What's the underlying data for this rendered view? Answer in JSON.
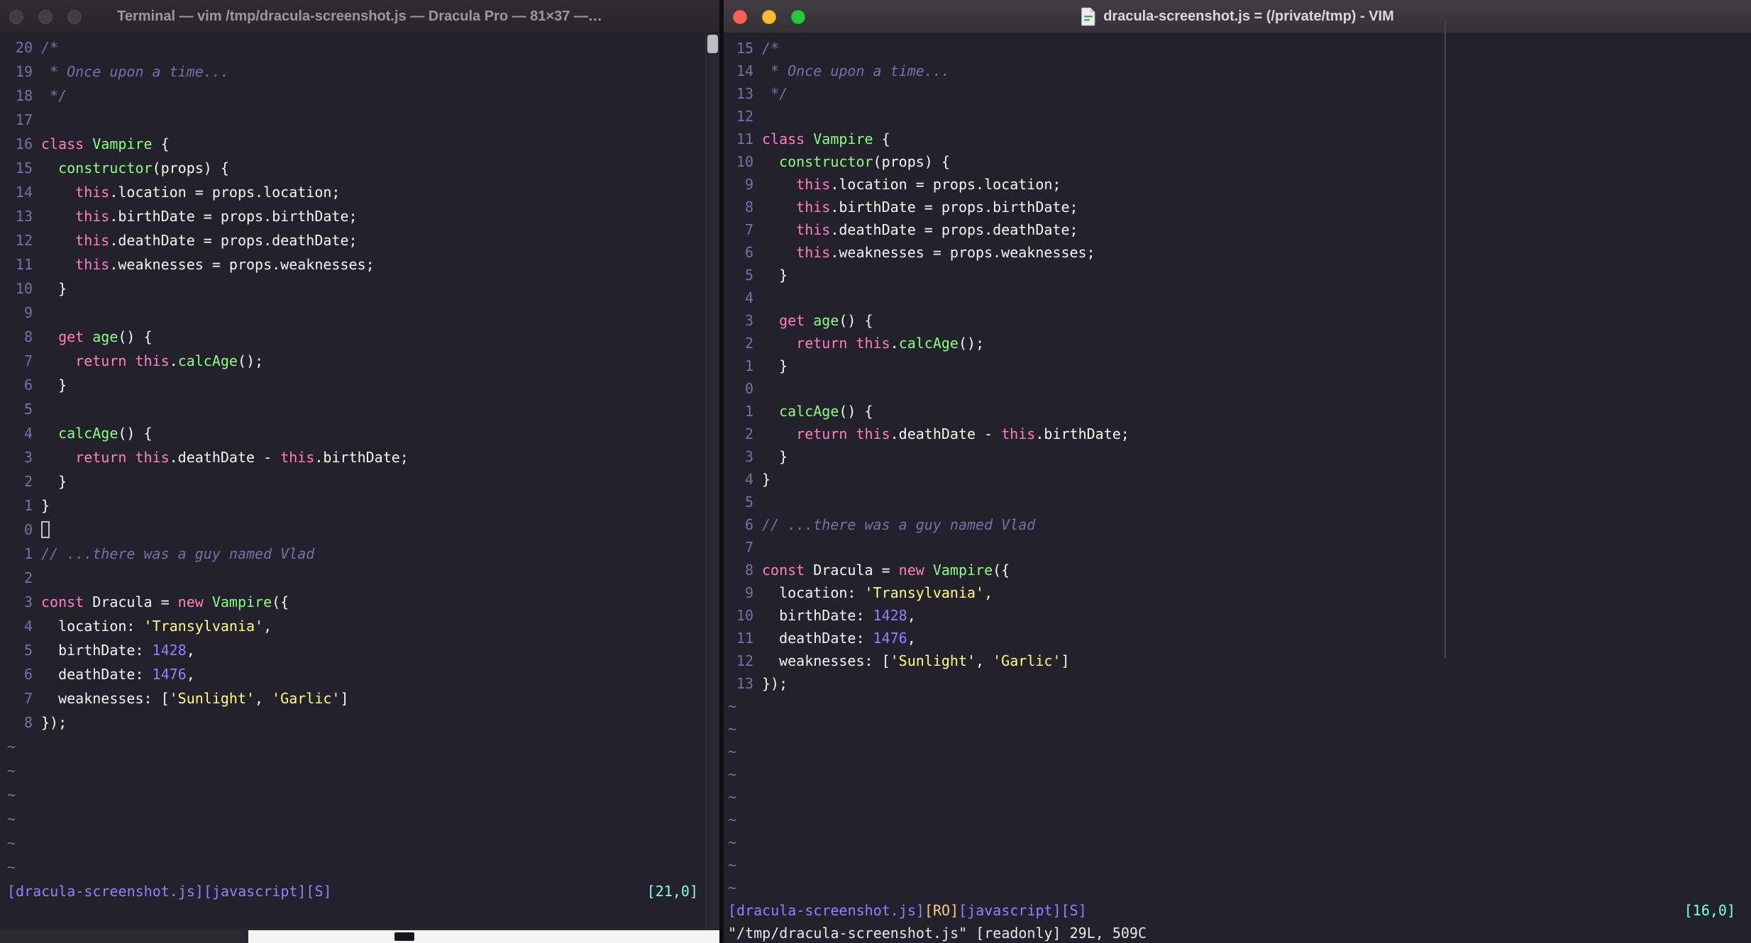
{
  "colors": {
    "bg": "#22212C",
    "fg": "#F8F8F2",
    "comment": "#7970A9",
    "pink": "#FF80BF",
    "green": "#8AFF80",
    "yellow": "#FFFF80",
    "purple": "#9580FF",
    "cyan": "#80FFEA",
    "orange": "#FFCA80",
    "tl-red": "#FF5F57",
    "tl-yellow": "#FEBC2E",
    "tl-green": "#28C840"
  },
  "tilde_char": "~",
  "left_window": {
    "title": "Terminal — vim /tmp/dracula-screenshot.js — Dracula Pro — 81×37 —…",
    "lines": [
      {
        "num": "20",
        "t": [
          [
            "com",
            "/*"
          ]
        ]
      },
      {
        "num": "19",
        "t": [
          [
            "com",
            " * Once upon a time..."
          ]
        ]
      },
      {
        "num": "18",
        "t": [
          [
            "com",
            " */"
          ]
        ]
      },
      {
        "num": "17",
        "t": []
      },
      {
        "num": "16",
        "t": [
          [
            "kw",
            "class"
          ],
          [
            "fg",
            " "
          ],
          [
            "fn",
            "Vampire"
          ],
          [
            "fg",
            " {"
          ]
        ]
      },
      {
        "num": "15",
        "t": [
          [
            "fg",
            "  "
          ],
          [
            "fn",
            "constructor"
          ],
          [
            "fg",
            "(props) {"
          ]
        ]
      },
      {
        "num": "14",
        "t": [
          [
            "fg",
            "    "
          ],
          [
            "kw",
            "this"
          ],
          [
            "fg",
            ".location = props.location;"
          ]
        ]
      },
      {
        "num": "13",
        "t": [
          [
            "fg",
            "    "
          ],
          [
            "kw",
            "this"
          ],
          [
            "fg",
            ".birthDate = props.birthDate;"
          ]
        ]
      },
      {
        "num": "12",
        "t": [
          [
            "fg",
            "    "
          ],
          [
            "kw",
            "this"
          ],
          [
            "fg",
            ".deathDate = props.deathDate;"
          ]
        ]
      },
      {
        "num": "11",
        "t": [
          [
            "fg",
            "    "
          ],
          [
            "kw",
            "this"
          ],
          [
            "fg",
            ".weaknesses = props.weaknesses;"
          ]
        ]
      },
      {
        "num": "10",
        "t": [
          [
            "fg",
            "  }"
          ]
        ]
      },
      {
        "num": "9",
        "t": []
      },
      {
        "num": "8",
        "t": [
          [
            "fg",
            "  "
          ],
          [
            "kw",
            "get"
          ],
          [
            "fg",
            " "
          ],
          [
            "fn",
            "age"
          ],
          [
            "fg",
            "() {"
          ]
        ]
      },
      {
        "num": "7",
        "t": [
          [
            "fg",
            "    "
          ],
          [
            "kw",
            "return"
          ],
          [
            "fg",
            " "
          ],
          [
            "kw",
            "this"
          ],
          [
            "fg",
            "."
          ],
          [
            "fn",
            "calcAge"
          ],
          [
            "fg",
            "();"
          ]
        ]
      },
      {
        "num": "6",
        "t": [
          [
            "fg",
            "  }"
          ]
        ]
      },
      {
        "num": "5",
        "t": []
      },
      {
        "num": "4",
        "t": [
          [
            "fg",
            "  "
          ],
          [
            "fn",
            "calcAge"
          ],
          [
            "fg",
            "() {"
          ]
        ]
      },
      {
        "num": "3",
        "t": [
          [
            "fg",
            "    "
          ],
          [
            "kw",
            "return"
          ],
          [
            "fg",
            " "
          ],
          [
            "kw",
            "this"
          ],
          [
            "fg",
            ".deathDate - "
          ],
          [
            "kw",
            "this"
          ],
          [
            "fg",
            ".birthDate;"
          ]
        ]
      },
      {
        "num": "2",
        "t": [
          [
            "fg",
            "  }"
          ]
        ]
      },
      {
        "num": "1",
        "t": [
          [
            "fg",
            "}"
          ]
        ]
      },
      {
        "num": "0",
        "t": [
          [
            "hcur",
            " "
          ]
        ]
      },
      {
        "num": "1",
        "t": [
          [
            "com",
            "// ...there was a guy named Vlad"
          ]
        ]
      },
      {
        "num": "2",
        "t": []
      },
      {
        "num": "3",
        "t": [
          [
            "kw",
            "const"
          ],
          [
            "fg",
            " Dracula = "
          ],
          [
            "kw",
            "new"
          ],
          [
            "fg",
            " "
          ],
          [
            "fn",
            "Vampire"
          ],
          [
            "fg",
            "({"
          ]
        ]
      },
      {
        "num": "4",
        "t": [
          [
            "fg",
            "  location: "
          ],
          [
            "str",
            "'Transylvania'"
          ],
          [
            "fg",
            ","
          ]
        ]
      },
      {
        "num": "5",
        "t": [
          [
            "fg",
            "  birthDate: "
          ],
          [
            "nm",
            "1428"
          ],
          [
            "fg",
            ","
          ]
        ]
      },
      {
        "num": "6",
        "t": [
          [
            "fg",
            "  deathDate: "
          ],
          [
            "nm",
            "1476"
          ],
          [
            "fg",
            ","
          ]
        ]
      },
      {
        "num": "7",
        "t": [
          [
            "fg",
            "  weaknesses: ["
          ],
          [
            "str",
            "'Sunlight'"
          ],
          [
            "fg",
            ", "
          ],
          [
            "str",
            "'Garlic'"
          ],
          [
            "fg",
            "]"
          ]
        ]
      },
      {
        "num": "8",
        "t": [
          [
            "fg",
            "});"
          ]
        ]
      }
    ],
    "tilde_count": 6,
    "status_tokens": [
      [
        "file",
        "[dracula-screenshot.js][javascript][S]"
      ]
    ],
    "ruler": "[21,0]"
  },
  "right_window": {
    "title": "dracula-screenshot.js = (/private/tmp) - VIM",
    "lines": [
      {
        "num": "15",
        "t": [
          [
            "com",
            "/*"
          ]
        ]
      },
      {
        "num": "14",
        "t": [
          [
            "com",
            " * Once upon a time..."
          ]
        ]
      },
      {
        "num": "13",
        "t": [
          [
            "com",
            " */"
          ]
        ]
      },
      {
        "num": "12",
        "t": []
      },
      {
        "num": "11",
        "t": [
          [
            "kw",
            "class"
          ],
          [
            "fg",
            " "
          ],
          [
            "fn",
            "Vampire"
          ],
          [
            "fg",
            " {"
          ]
        ]
      },
      {
        "num": "10",
        "t": [
          [
            "fg",
            "  "
          ],
          [
            "fn",
            "constructor"
          ],
          [
            "fg",
            "(props) {"
          ]
        ]
      },
      {
        "num": "9",
        "t": [
          [
            "fg",
            "    "
          ],
          [
            "kw",
            "this"
          ],
          [
            "fg",
            ".location = props.location;"
          ]
        ]
      },
      {
        "num": "8",
        "t": [
          [
            "fg",
            "    "
          ],
          [
            "kw",
            "this"
          ],
          [
            "fg",
            ".birthDate = props.birthDate;"
          ]
        ]
      },
      {
        "num": "7",
        "t": [
          [
            "fg",
            "    "
          ],
          [
            "kw",
            "this"
          ],
          [
            "fg",
            ".deathDate = props.deathDate;"
          ]
        ]
      },
      {
        "num": "6",
        "t": [
          [
            "fg",
            "    "
          ],
          [
            "kw",
            "this"
          ],
          [
            "fg",
            ".weaknesses = props.weaknesses;"
          ]
        ]
      },
      {
        "num": "5",
        "t": [
          [
            "fg",
            "  }"
          ]
        ]
      },
      {
        "num": "4",
        "t": []
      },
      {
        "num": "3",
        "t": [
          [
            "fg",
            "  "
          ],
          [
            "kw",
            "get"
          ],
          [
            "fg",
            " "
          ],
          [
            "fn",
            "age"
          ],
          [
            "fg",
            "() {"
          ]
        ]
      },
      {
        "num": "2",
        "t": [
          [
            "fg",
            "    "
          ],
          [
            "kw",
            "return"
          ],
          [
            "fg",
            " "
          ],
          [
            "kw",
            "this"
          ],
          [
            "fg",
            "."
          ],
          [
            "fn",
            "calcAge"
          ],
          [
            "fg",
            "();"
          ]
        ]
      },
      {
        "num": "1",
        "t": [
          [
            "fg",
            "  }"
          ]
        ]
      },
      {
        "num": "0",
        "t": []
      },
      {
        "num": "1",
        "t": [
          [
            "fg",
            "  "
          ],
          [
            "fn",
            "calcAge"
          ],
          [
            "fg",
            "() {"
          ]
        ]
      },
      {
        "num": "2",
        "t": [
          [
            "fg",
            "    "
          ],
          [
            "kw",
            "return"
          ],
          [
            "fg",
            " "
          ],
          [
            "kw",
            "this"
          ],
          [
            "fg",
            ".deathDate - "
          ],
          [
            "kw",
            "this"
          ],
          [
            "fg",
            ".birthDate;"
          ]
        ]
      },
      {
        "num": "3",
        "t": [
          [
            "fg",
            "  }"
          ]
        ]
      },
      {
        "num": "4",
        "t": [
          [
            "fg",
            "}"
          ]
        ]
      },
      {
        "num": "5",
        "t": []
      },
      {
        "num": "6",
        "t": [
          [
            "com",
            "// ...there was a guy named Vlad"
          ]
        ]
      },
      {
        "num": "7",
        "t": []
      },
      {
        "num": "8",
        "t": [
          [
            "kw",
            "const"
          ],
          [
            "fg",
            " Dracula = "
          ],
          [
            "kw",
            "new"
          ],
          [
            "fg",
            " "
          ],
          [
            "fn",
            "Vampire"
          ],
          [
            "fg",
            "({"
          ]
        ]
      },
      {
        "num": "9",
        "t": [
          [
            "fg",
            "  location: "
          ],
          [
            "str",
            "'Transylvania'"
          ],
          [
            "fg",
            ","
          ]
        ]
      },
      {
        "num": "10",
        "t": [
          [
            "fg",
            "  birthDate: "
          ],
          [
            "nm",
            "1428"
          ],
          [
            "fg",
            ","
          ]
        ]
      },
      {
        "num": "11",
        "t": [
          [
            "fg",
            "  deathDate: "
          ],
          [
            "nm",
            "1476"
          ],
          [
            "fg",
            ","
          ]
        ]
      },
      {
        "num": "12",
        "t": [
          [
            "fg",
            "  weaknesses: ["
          ],
          [
            "str",
            "'Sunlight'"
          ],
          [
            "fg",
            ", "
          ],
          [
            "str",
            "'Garlic'"
          ],
          [
            "fg",
            "]"
          ]
        ]
      },
      {
        "num": "13",
        "t": [
          [
            "fg",
            "});"
          ]
        ]
      }
    ],
    "tilde_count": 9,
    "status_tokens": [
      [
        "file",
        "[dracula-screenshot.js]"
      ],
      [
        "ro",
        "[RO]"
      ],
      [
        "file",
        "[javascript][S]"
      ]
    ],
    "ruler": "[16,0]",
    "cmdline": "\"/tmp/dracula-screenshot.js\" [readonly] 29L, 509C"
  }
}
